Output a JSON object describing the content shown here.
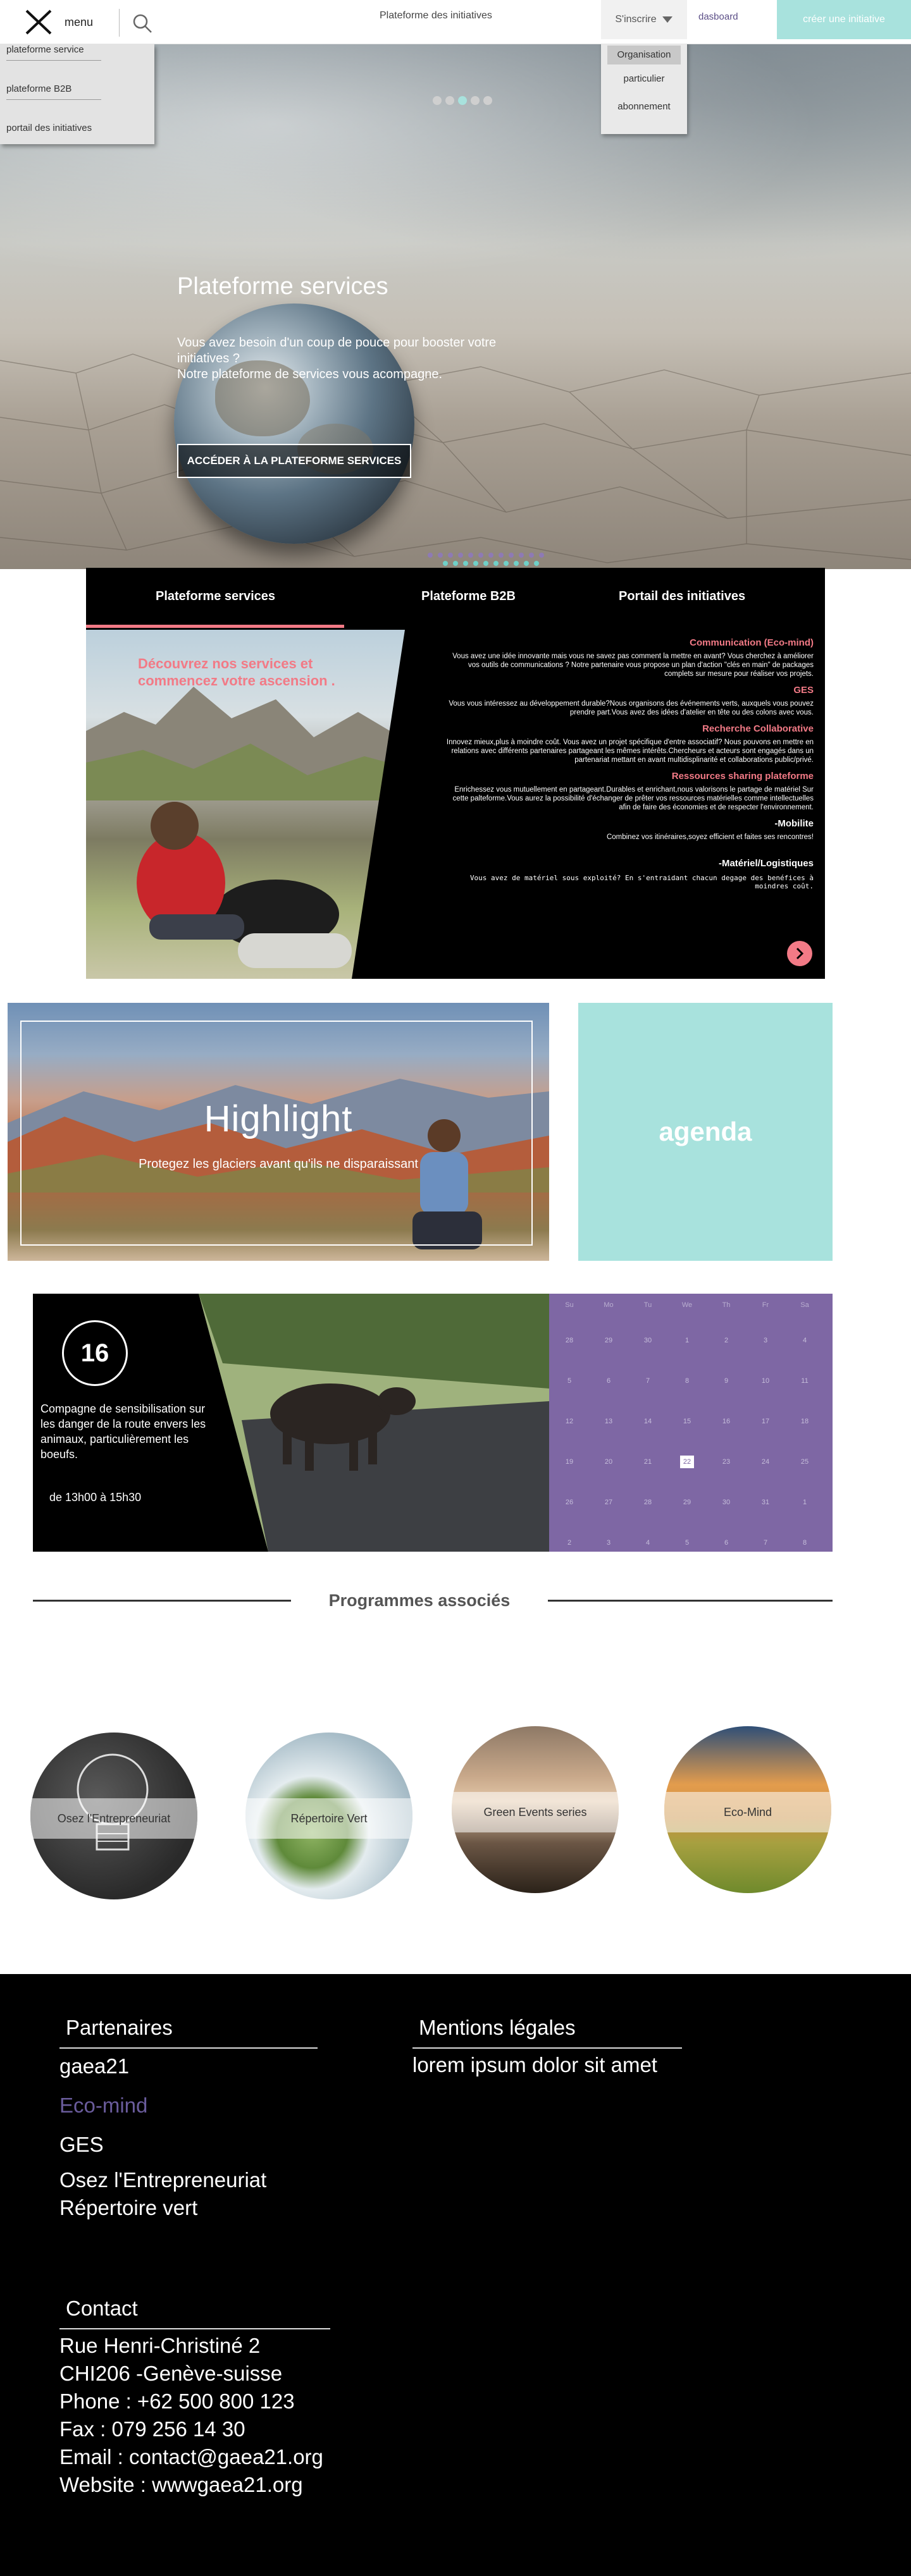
{
  "topbar": {
    "menu_label": "menu",
    "nav_initiatives": "Plateforme des initiatives",
    "inscrire_label": "S'inscrire",
    "dashboard_label": "dasboard",
    "create_label": "créer une initiative"
  },
  "side_menu": {
    "items": [
      "plateforme service",
      "plateforme B2B",
      "portail des initiatives"
    ]
  },
  "inscrire_menu": {
    "items": [
      "Organisation",
      "particulier",
      "abonnement"
    ]
  },
  "hero": {
    "title": "Plateforme services",
    "text_line1": "Vous avez besoin d'un coup de pouce pour booster votre initiatives ?",
    "text_line2": "Notre plateforme de services vous acompagne.",
    "cta": "ACCÉDER À LA PLATEFORME SERVICES",
    "slide_count": 5,
    "active_slide": 3
  },
  "tabs": {
    "items": [
      "Plateforme services",
      "Plateforme B2B",
      "Portail des initiatives"
    ],
    "active": 0,
    "photo_title": "Découvrez nos services et commencez votre ascension .",
    "sections": [
      {
        "heading": "Communication (Eco-mind)",
        "body": "Vous avez une idée innovante mais vous  ne savez pas comment la mettre en avant? Vous cherchez à améliorer vos outils de communications ? Notre partenaire vous propose un plan d'action \"clés en main\" de packages complets sur mesure pour réaliser vos projets."
      },
      {
        "heading": "GES",
        "body": "Vous vous intéressez au développement durable?Nous organisons des événements verts, auxquels vous pouvez prendre part.Vous avez des idées d'atelier en tête ou des colons avec vous."
      },
      {
        "heading": "Recherche Collaborative",
        "body": "Innovez  mieux,plus à moindre coût. Vous avez un projet spécifique d'entre associatif? Nous pouvons en mettre en relations avec différents partenaires partageant les mêmes intérêts.Chercheurs et acteurs sont engagés dans un partenariat mettant en avant multidisplinarité et collaborations public/privé."
      },
      {
        "heading": "Ressources sharing plateforme",
        "body": "Enrichessez vous mutuellement en partageant.Durables et enrichant,nous valorisons le partage de matériel Sur cette palteforme.Vous aurez la possibilité d'échanger de prêter vos ressources matérielles comme intellectuelles afin de faire des économies et de respecter l'environnement."
      },
      {
        "heading": "-Mobilite",
        "body": "Combinez vos itinéraires,soyez efficient et faites ses rencontres!"
      },
      {
        "heading": "-Matériel/Logistiques",
        "body": "Vous avez de matériel sous  exploité? En s'entraidant chacun degage des benéfices à moindres coût."
      }
    ]
  },
  "highlight": {
    "title": "Highlight",
    "text": "Protegez les glaciers avant qu'ils ne disparaissant"
  },
  "agenda": {
    "label": "agenda"
  },
  "event": {
    "day": "16",
    "description": "Compagne  de sensibilisation sur les danger de la route envers les animaux, particulièrement les  boeufs.",
    "time": "de 13h00 à 15h30"
  },
  "calendar": {
    "weekdays": [
      "Su",
      "Mo",
      "Tu",
      "We",
      "Th",
      "Fr",
      "Sa"
    ],
    "weeks": [
      [
        "28",
        "29",
        "30",
        "1",
        "2",
        "3",
        "4"
      ],
      [
        "5",
        "6",
        "7",
        "8",
        "9",
        "10",
        "11"
      ],
      [
        "12",
        "13",
        "14",
        "15",
        "16",
        "17",
        "18"
      ],
      [
        "19",
        "20",
        "21",
        "22",
        "23",
        "24",
        "25"
      ],
      [
        "26",
        "27",
        "28",
        "29",
        "30",
        "31",
        "1"
      ],
      [
        "2",
        "3",
        "4",
        "5",
        "6",
        "7",
        "8"
      ]
    ],
    "highlighted_day": "22"
  },
  "programmes": {
    "title": "Programmes associés",
    "items": [
      "Osez l'Entrepreneuriat",
      "Répertoire  Vert",
      "Green Events series",
      "Eco-Mind"
    ]
  },
  "footer": {
    "partners_title": "Partenaires",
    "partners": [
      "gaea21",
      "Eco-mind",
      "GES",
      "Osez l'Entrepreneuriat",
      "Répertoire vert"
    ],
    "legal_title": "Mentions légales",
    "legal_text": "lorem ipsum dolor sit amet",
    "contact_title": "Contact",
    "contact_lines": [
      "Rue Henri-Christiné 2",
      "CHI206 -Genève-suisse",
      "Phone : +62 500 800 123",
      "Fax : 079 256 14 30",
      "Email : contact@gaea21.org",
      "Website : wwwgaea21.org"
    ]
  },
  "colors": {
    "accent_teal": "#a8e2dd",
    "accent_pink": "#f27a86",
    "calendar_purple": "#7e67a4",
    "footer_accent": "#6a5c9c"
  }
}
